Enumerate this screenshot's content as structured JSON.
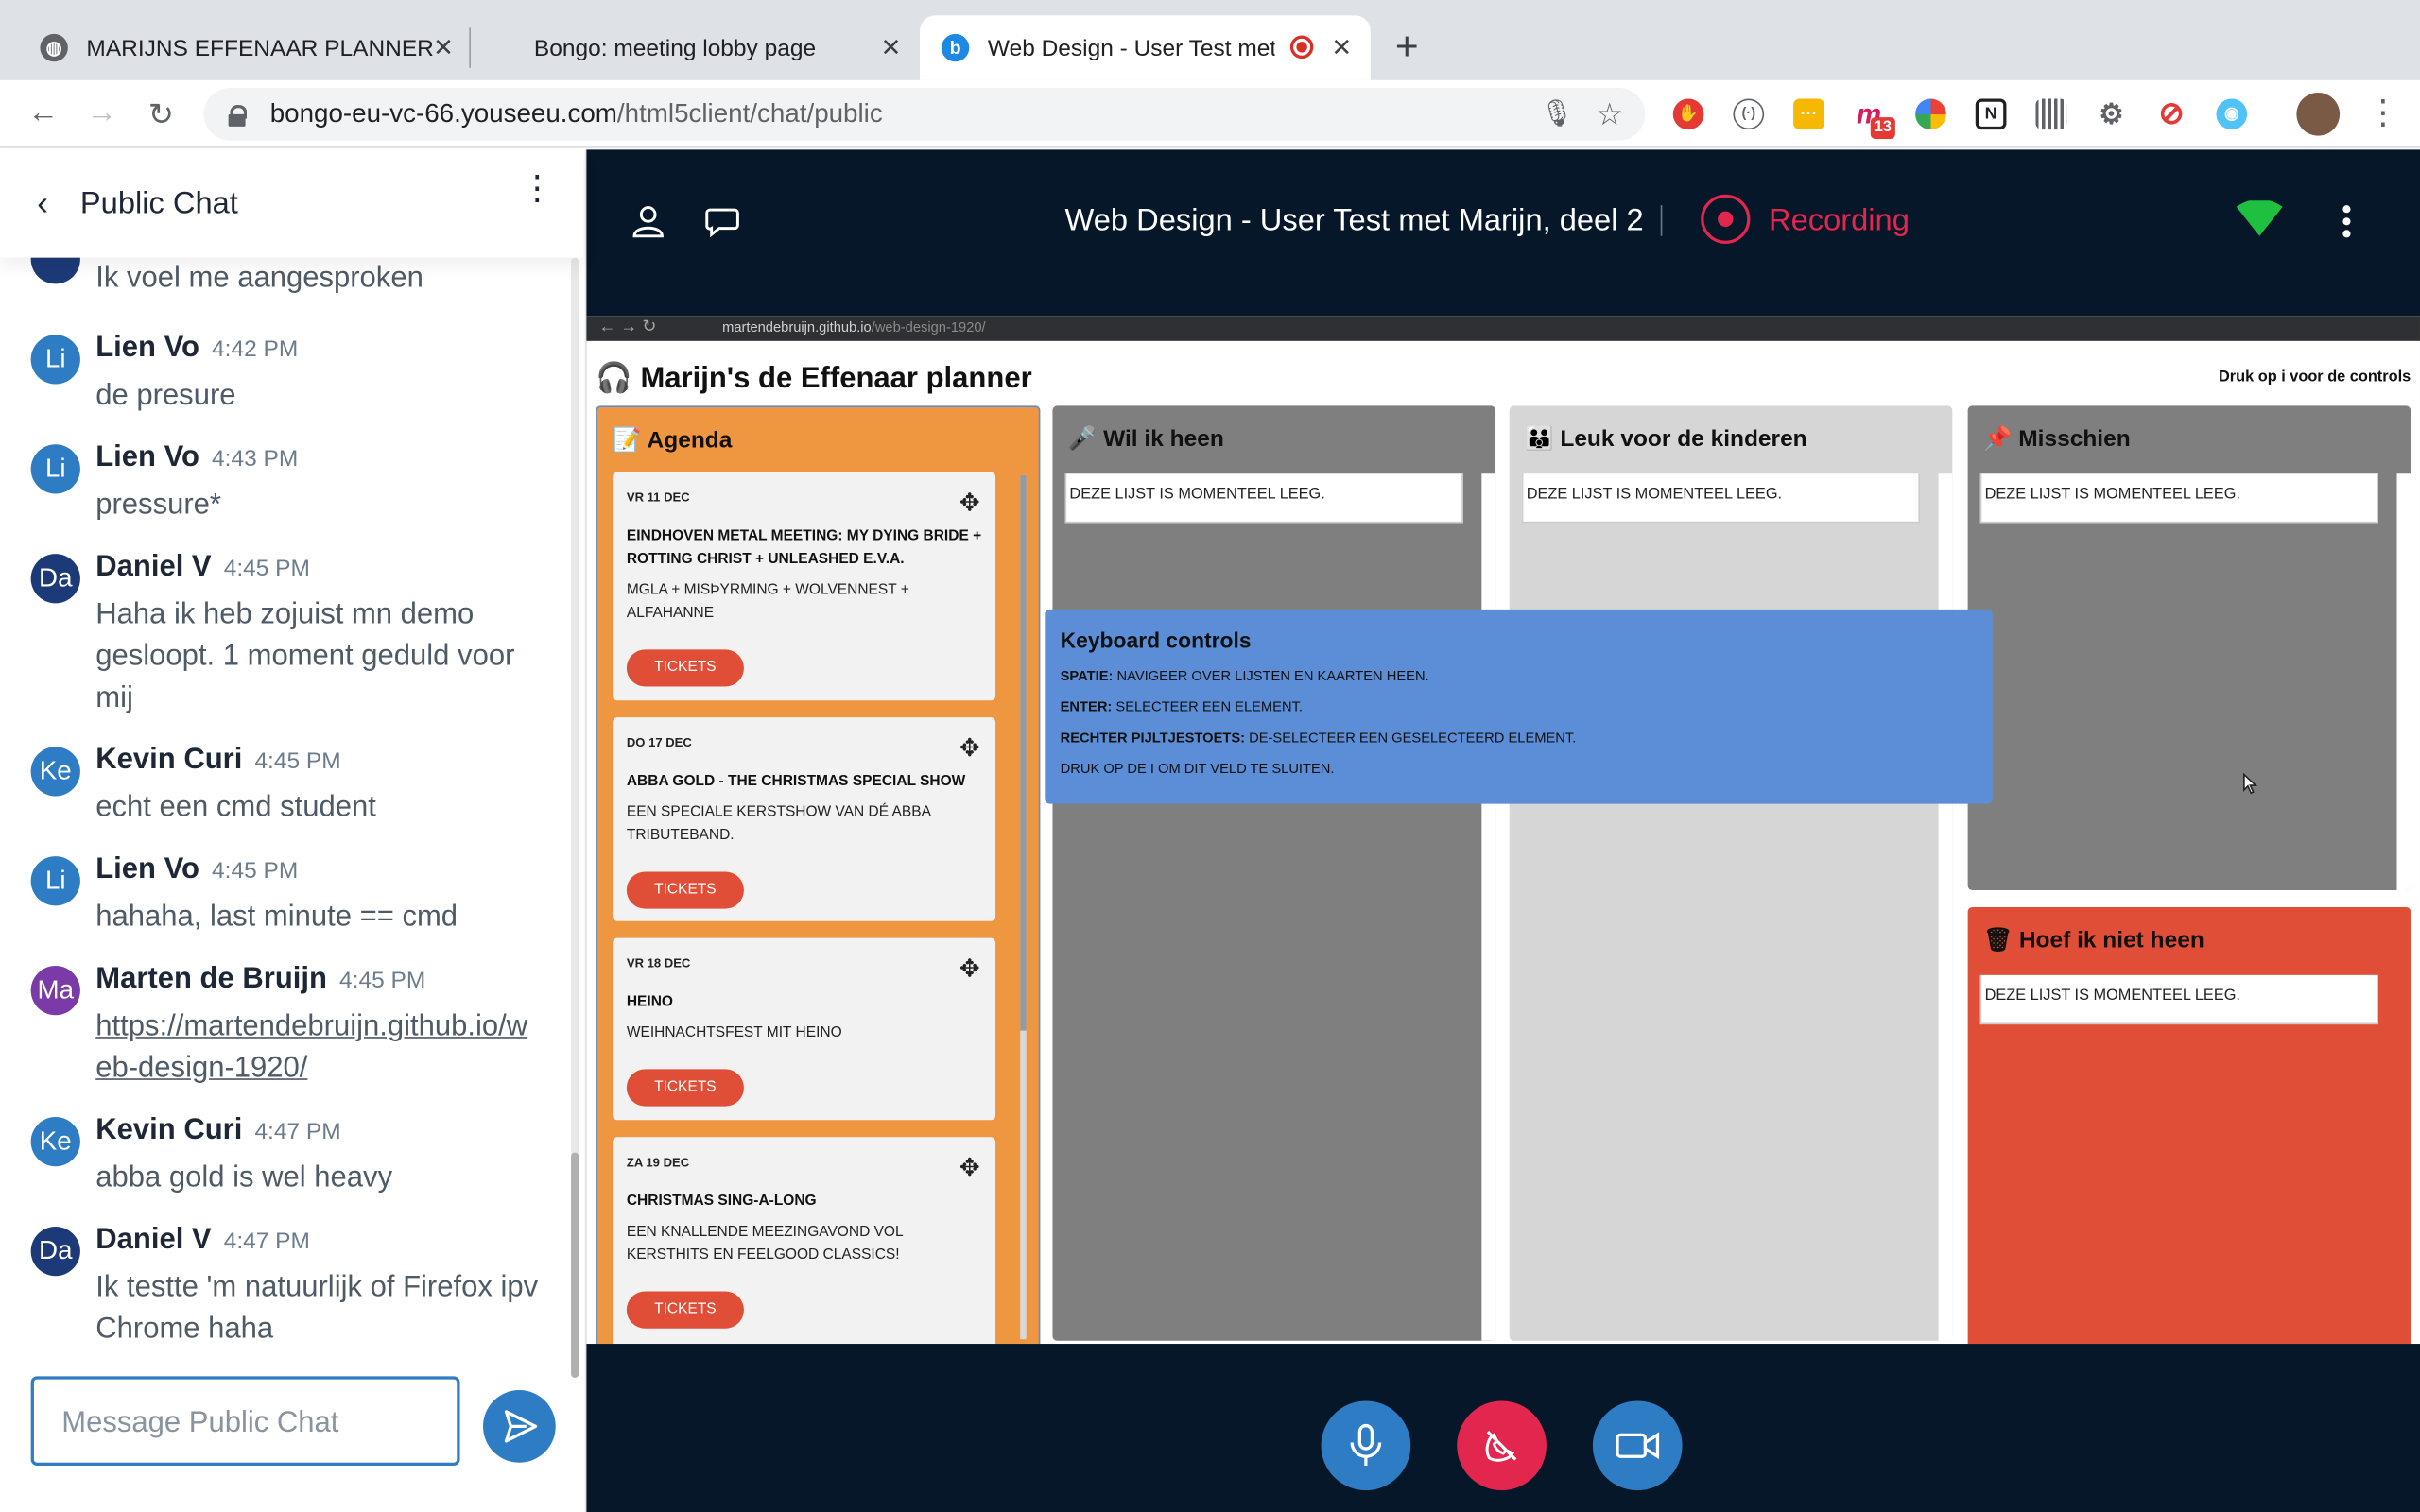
{
  "browser": {
    "tabs": [
      {
        "title": "MARIJNS EFFENAAR PLANNER",
        "active": false
      },
      {
        "title": "Bongo: meeting lobby page",
        "active": false
      },
      {
        "title": "Web Design - User Test met",
        "active": true
      }
    ],
    "url_host": "bongo-eu-vc-66.youseeu.com",
    "url_path": "/html5client/chat/public",
    "ext_badge": "13",
    "ext_n": "N"
  },
  "chat": {
    "title": "Public Chat",
    "truncated_text": "Ik voel me aangesproken",
    "messages": [
      {
        "initials": "Li",
        "name": "Lien Vo",
        "time": "4:42 PM",
        "text": "de presure",
        "color": "#2d7cc4"
      },
      {
        "initials": "Li",
        "name": "Lien Vo",
        "time": "4:43 PM",
        "text": "pressure*",
        "color": "#2d7cc4"
      },
      {
        "initials": "Da",
        "name": "Daniel V",
        "time": "4:45 PM",
        "text": "Haha ik heb zojuist mn demo gesloopt. 1 moment geduld voor mij",
        "color": "#1d3a78"
      },
      {
        "initials": "Ke",
        "name": "Kevin Curi",
        "time": "4:45 PM",
        "text": "echt een cmd student",
        "color": "#2d7cc4"
      },
      {
        "initials": "Li",
        "name": "Lien Vo",
        "time": "4:45 PM",
        "text": "hahaha, last minute == cmd",
        "color": "#2d7cc4"
      },
      {
        "initials": "Ma",
        "name": "Marten de Bruijn",
        "time": "4:45 PM",
        "text": "https://martendebruijn.github.io/web-design-1920/",
        "color": "#7a3aa8"
      },
      {
        "initials": "Ke",
        "name": "Kevin Curi",
        "time": "4:47 PM",
        "text": "abba gold is wel heavy",
        "color": "#2d7cc4"
      },
      {
        "initials": "Da",
        "name": "Daniel V",
        "time": "4:47 PM",
        "text": "Ik testte 'm natuurlijk of Firefox ipv Chrome haha",
        "color": "#1d3a78"
      }
    ],
    "placeholder": "Message Public Chat"
  },
  "meeting": {
    "title": "Web Design - User Test met Marijn, deel 2",
    "recording_label": "Recording"
  },
  "shared_screen": {
    "url_host": "martendebruijn.github.io",
    "url_path": "/web-design-1920/",
    "planner_title": "🎧 Marijn's de Effenaar planner",
    "hint": "Druk op i voor de controls",
    "empty_text": "DEZE LIJST IS MOMENTEEL LEEG.",
    "columns": [
      {
        "title": "📝 Agenda"
      },
      {
        "title": "🎤 Wil ik heen"
      },
      {
        "title": "👪 Leuk voor de kinderen"
      },
      {
        "title": "📌 Misschien"
      },
      {
        "title": "🗑 Hoef ik niet heen"
      }
    ],
    "events": [
      {
        "date": "VR 11 DEC",
        "title": "EINDHOVEN METAL MEETING: MY DYING BRIDE + ROTTING CHRIST + UNLEASHED E.V.A.",
        "desc": "MGLA + MISÞYRMING + WOLVENNEST + ALFAHANNE",
        "button": "TICKETS"
      },
      {
        "date": "DO 17 DEC",
        "title": "ABBA GOLD - THE CHRISTMAS SPECIAL SHOW",
        "desc": "EEN SPECIALE KERSTSHOW VAN DÉ ABBA TRIBUTEBAND.",
        "button": "TICKETS"
      },
      {
        "date": "VR 18 DEC",
        "title": "HEINO",
        "desc": "WEIHNACHTSFEST MIT HEINO",
        "button": "TICKETS"
      },
      {
        "date": "ZA 19 DEC",
        "title": "CHRISTMAS SING-A-LONG",
        "desc": "EEN KNALLENDE MEEZINGAVOND VOL KERSTHITS EN FEELGOOD CLASSICS!",
        "button": "TICKETS"
      }
    ],
    "keyboard": {
      "title": "Keyboard controls",
      "lines": [
        {
          "key": "SPATIE:",
          "desc": " NAVIGEER OVER LIJSTEN EN KAARTEN HEEN."
        },
        {
          "key": "ENTER:",
          "desc": " SELECTEER EEN ELEMENT."
        },
        {
          "key": "RECHTER PIJLTJESTOETS:",
          "desc": " DE-SELECTEER EEN GESELECTEERD ELEMENT."
        },
        {
          "key": "",
          "desc": "DRUK OP DE I OM DIT VELD TE SLUITEN."
        }
      ]
    }
  }
}
